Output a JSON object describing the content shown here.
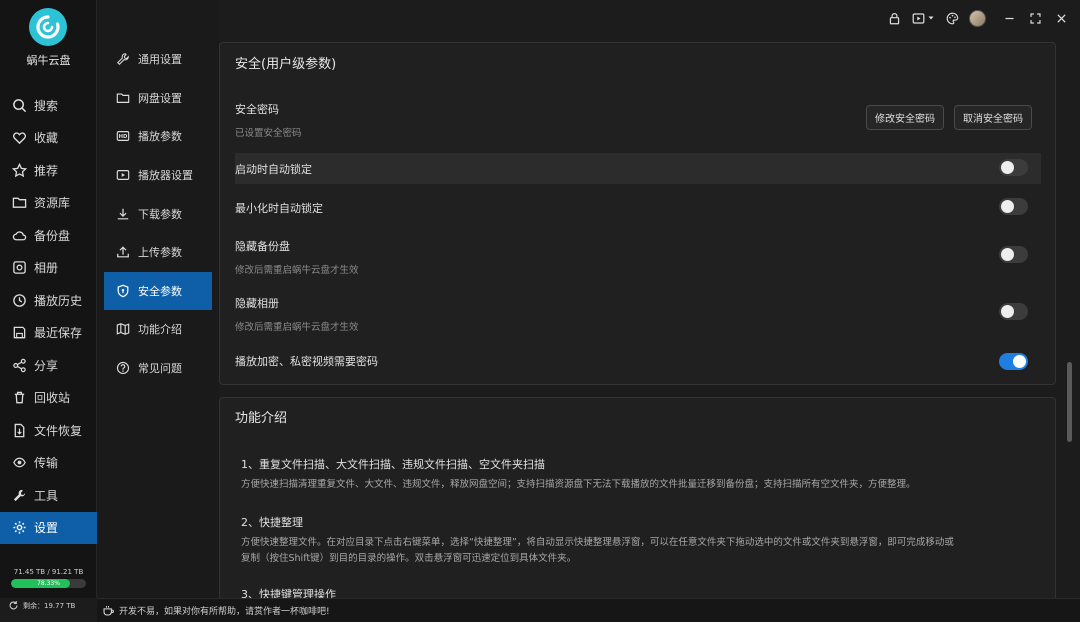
{
  "app": {
    "name": "蜗牛云盘"
  },
  "nav": [
    {
      "label": "搜索",
      "icon": "search-icon"
    },
    {
      "label": "收藏",
      "icon": "heart-icon"
    },
    {
      "label": "推荐",
      "icon": "star-icon"
    },
    {
      "label": "资源库",
      "icon": "folder-icon"
    },
    {
      "label": "备份盘",
      "icon": "cloud-icon"
    },
    {
      "label": "相册",
      "icon": "photo-icon"
    },
    {
      "label": "播放历史",
      "icon": "clock-icon"
    },
    {
      "label": "最近保存",
      "icon": "save-icon"
    },
    {
      "label": "分享",
      "icon": "share-icon"
    },
    {
      "label": "回收站",
      "icon": "trash-icon"
    },
    {
      "label": "文件恢复",
      "icon": "file-restore-icon"
    },
    {
      "label": "传输",
      "icon": "transfer-icon"
    },
    {
      "label": "工具",
      "icon": "wrench-icon"
    },
    {
      "label": "设置",
      "icon": "gear-icon",
      "active": true
    }
  ],
  "storage": {
    "usage": "71.45 TB / 91.21 TB",
    "percent_label": "78.33%",
    "percent": 78.33,
    "remaining": "剩余：19.77 TB"
  },
  "submenu": [
    {
      "label": "通用设置",
      "icon": "wrench-icon"
    },
    {
      "label": "网盘设置",
      "icon": "folder-icon"
    },
    {
      "label": "播放参数",
      "icon": "hd-icon"
    },
    {
      "label": "播放器设置",
      "icon": "player-icon"
    },
    {
      "label": "下载参数",
      "icon": "download-icon"
    },
    {
      "label": "上传参数",
      "icon": "upload-icon"
    },
    {
      "label": "安全参数",
      "icon": "shield-icon",
      "active": true
    },
    {
      "label": "功能介绍",
      "icon": "map-icon"
    },
    {
      "label": "常见问题",
      "icon": "question-icon"
    }
  ],
  "security": {
    "title": "安全(用户级参数)",
    "password_label": "安全密码",
    "password_status": "已设置安全密码",
    "change_btn": "修改安全密码",
    "cancel_btn": "取消安全密码",
    "auto_lock_start": "启动时自动锁定",
    "auto_lock_min": "最小化时自动锁定",
    "hide_backup": "隐藏备份盘",
    "hide_backup_sub": "修改后需重启蜗牛云盘才生效",
    "hide_album": "隐藏相册",
    "hide_album_sub": "修改后需重启蜗牛云盘才生效",
    "play_encrypted": "播放加密、私密视频需要密码"
  },
  "features": {
    "title": "功能介绍",
    "h1": "1、重复文件扫描、大文件扫描、违规文件扫描、空文件夹扫描",
    "p1": "方便快速扫描清理重复文件、大文件、违规文件，释放网盘空间；支持扫描资源盘下无法下载播放的文件批量迁移到备份盘；支持扫描所有空文件夹，方便整理。",
    "h2": "2、快捷整理",
    "p2a": "方便快速整理文件。在对应目录下点击右键菜单，选择“快捷整理”，将自动显示快捷整理悬浮窗，可以在任意文件夹下拖动选中的文件或文件夹到悬浮窗，即可完成移动或",
    "p2b": "复制（按住Shift键）到目的目录的操作。双击悬浮窗可迅速定位到具体文件夹。",
    "h3": "3、快捷键管理操作"
  },
  "status": {
    "text": "开发不易，如果对你有所帮助，请赏作者一杯咖啡吧!"
  },
  "colors": {
    "accent": "#0f5fa8",
    "toggle_on": "#1e7fe0",
    "progress": "#22c05a",
    "logo": "#2dc3d6"
  }
}
